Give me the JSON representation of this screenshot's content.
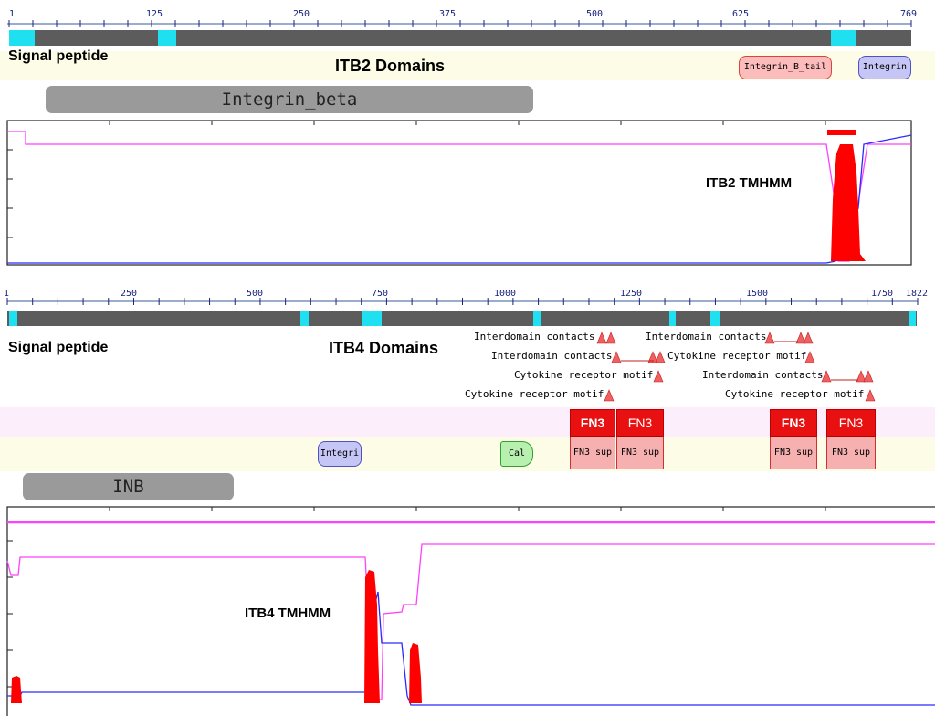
{
  "itb2": {
    "ruler_ticks": [
      "1",
      "125",
      "250",
      "375",
      "500",
      "625",
      "769"
    ],
    "signal_label": "Signal peptide",
    "domains_label": "ITB2 Domains",
    "domain_boxes": [
      {
        "label": "Integrin_B_tail"
      },
      {
        "label": "Integrin"
      }
    ],
    "family_label": "Integrin_beta",
    "tmhmm_label": "ITB2 TMHMM"
  },
  "itb4": {
    "ruler_ticks": [
      "1",
      "250",
      "500",
      "750",
      "1000",
      "1250",
      "1500",
      "1750",
      "1822"
    ],
    "signal_label": "Signal peptide",
    "domains_label": "ITB4 Domains",
    "motifs": [
      {
        "label": "Interdomain contacts"
      },
      {
        "label": "Interdomain contacts"
      },
      {
        "label": "Cytokine receptor motif"
      },
      {
        "label": "Cytokine receptor motif"
      },
      {
        "label": "Interdomain contacts"
      },
      {
        "label": "Cytokine receptor motif"
      },
      {
        "label": "Interdomain contacts"
      },
      {
        "label": "Cytokine receptor motif"
      }
    ],
    "fn3": [
      {
        "label": "FN3",
        "sup": "FN3 sup"
      },
      {
        "label": "FN3",
        "sup": "FN3 sup"
      },
      {
        "label": "FN3",
        "sup": "FN3 sup"
      },
      {
        "label": "FN3",
        "sup": "FN3 sup"
      }
    ],
    "domain_boxes": [
      {
        "label": "Integri"
      },
      {
        "label": "Cal"
      }
    ],
    "family_label": "INB",
    "tmhmm_label": "ITB4 TMHMM"
  },
  "colors": {
    "ruler_bar": "#5c5c5c",
    "segment": "#1ee0f0",
    "band_yellow": "#fdfce6",
    "band_pink": "#fdeefb",
    "tm_red": "#ff0000",
    "inside_blue": "#2a2aff",
    "outside_magenta": "#ff40ff"
  }
}
